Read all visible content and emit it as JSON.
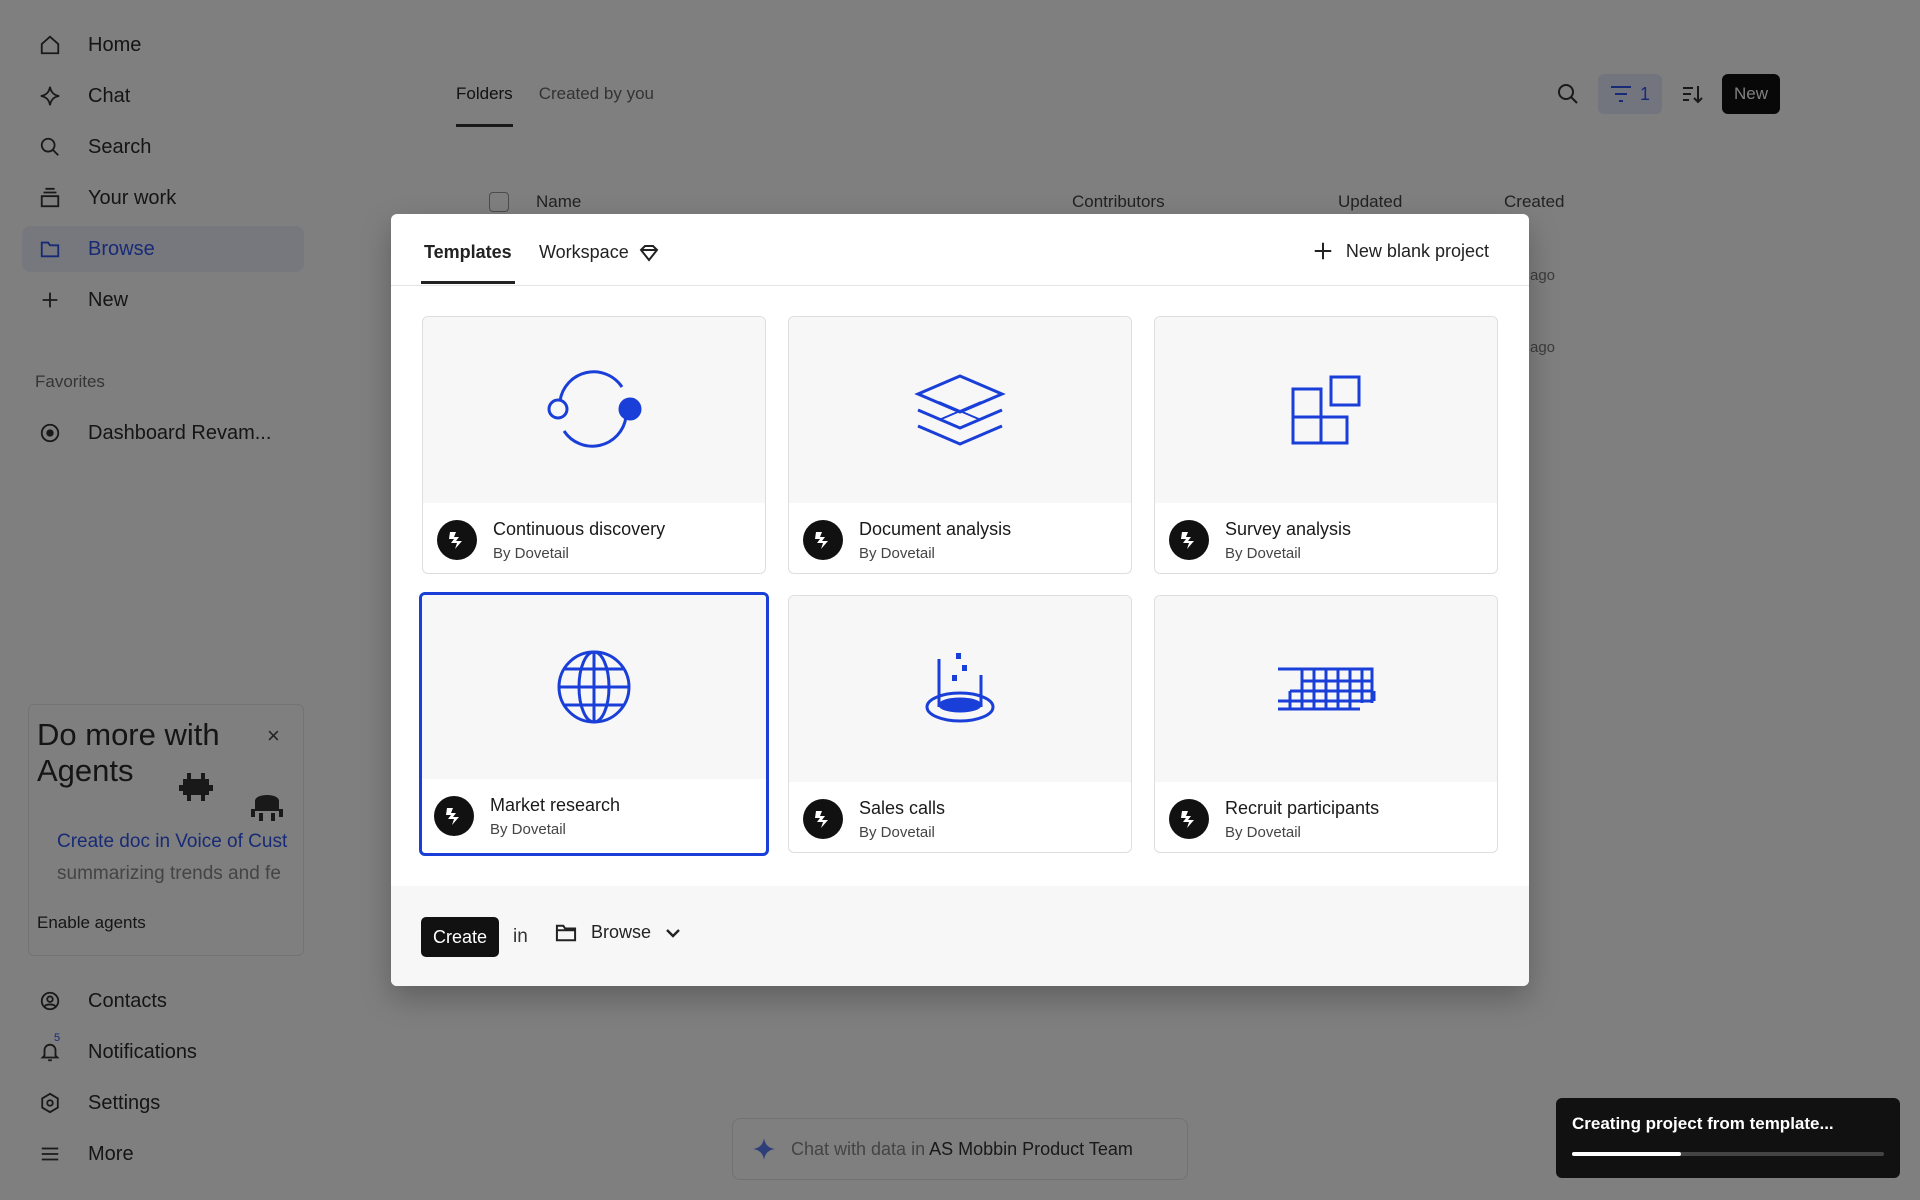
{
  "sidebar": {
    "items": [
      {
        "label": "Home",
        "icon": "home-icon"
      },
      {
        "label": "Chat",
        "icon": "sparkle-icon"
      },
      {
        "label": "Search",
        "icon": "search-icon"
      },
      {
        "label": "Your work",
        "icon": "stack-icon"
      },
      {
        "label": "Browse",
        "icon": "folder-icon",
        "active": true
      },
      {
        "label": "New",
        "icon": "plus-icon"
      }
    ],
    "favorites_heading": "Favorites",
    "favorites": [
      {
        "label": "Dashboard Revam...",
        "icon": "compass-icon"
      }
    ],
    "bottom_items": [
      {
        "label": "Contacts",
        "icon": "person-icon"
      },
      {
        "label": "Notifications",
        "icon": "bell-icon",
        "badge": "5"
      },
      {
        "label": "Settings",
        "icon": "gear-icon"
      },
      {
        "label": "More",
        "icon": "menu-icon"
      }
    ]
  },
  "agents_promo": {
    "title": "Do more with Agents",
    "close": "×",
    "link": "Create doc in Voice of Cust",
    "sub": "summarizing trends and fe",
    "enable": "Enable agents"
  },
  "main": {
    "tabs": [
      "Folders",
      "Created by you"
    ],
    "active_tab": "Folders",
    "filter_count": "1",
    "new_label": "New",
    "columns": [
      "Name",
      "Contributors",
      "Updated",
      "Created"
    ],
    "row_suffix": "ago",
    "chat_prefix": "Chat with data in",
    "chat_team": "AS Mobbin Product Team"
  },
  "modal": {
    "tabs": [
      "Templates",
      "Workspace"
    ],
    "active_tab": "Templates",
    "new_blank": "New blank project",
    "templates": [
      {
        "title": "Continuous discovery",
        "by": "By Dovetail",
        "icon": "orbit-icon"
      },
      {
        "title": "Document analysis",
        "by": "By Dovetail",
        "icon": "layers-icon"
      },
      {
        "title": "Survey analysis",
        "by": "By Dovetail",
        "icon": "blocks-icon"
      },
      {
        "title": "Market research",
        "by": "By Dovetail",
        "icon": "globe-icon",
        "selected": true
      },
      {
        "title": "Sales calls",
        "by": "By Dovetail",
        "icon": "beaker-icon"
      },
      {
        "title": "Recruit participants",
        "by": "By Dovetail",
        "icon": "grid-steps-icon"
      }
    ],
    "create": "Create",
    "in": "in",
    "folder": "Browse"
  },
  "toast": {
    "text": "Creating project from template...",
    "progress": 0.35
  },
  "colors": {
    "accent": "#1a3fd8",
    "overlay": "rgba(0,0,0,0.5)",
    "dark": "#111111"
  }
}
